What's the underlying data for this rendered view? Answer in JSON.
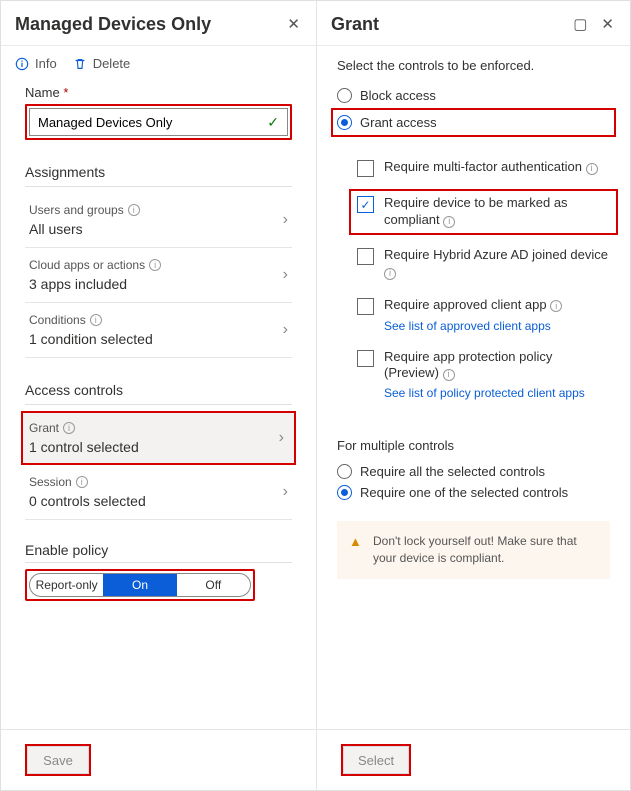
{
  "left": {
    "title": "Managed Devices Only",
    "info": "Info",
    "delete": "Delete",
    "nameLabel": "Name",
    "nameValue": "Managed Devices Only",
    "assignmentsTitle": "Assignments",
    "usersGroups": {
      "label": "Users and groups",
      "value": "All users"
    },
    "cloudApps": {
      "label": "Cloud apps or actions",
      "value": "3 apps included"
    },
    "conditions": {
      "label": "Conditions",
      "value": "1 condition selected"
    },
    "accessTitle": "Access controls",
    "grant": {
      "label": "Grant",
      "value": "1 control selected"
    },
    "session": {
      "label": "Session",
      "value": "0 controls selected"
    },
    "enableTitle": "Enable policy",
    "segReport": "Report-only",
    "segOn": "On",
    "segOff": "Off",
    "save": "Save"
  },
  "right": {
    "title": "Grant",
    "instruction": "Select the controls to be enforced.",
    "radioBlock": "Block access",
    "radioGrant": "Grant access",
    "chkMfa": "Require multi-factor authentication",
    "chkCompliant": "Require device to be marked as compliant",
    "chkHybrid": "Require Hybrid Azure AD joined device",
    "chkApproved": "Require approved client app",
    "linkApproved": "See list of approved client apps",
    "chkProtection": "Require app protection policy (Preview)",
    "linkProtection": "See list of policy protected client apps",
    "multiTitle": "For multiple controls",
    "radioAll": "Require all the selected controls",
    "radioOne": "Require one of the selected controls",
    "warning": "Don't lock yourself out! Make sure that your device is compliant.",
    "select": "Select"
  }
}
